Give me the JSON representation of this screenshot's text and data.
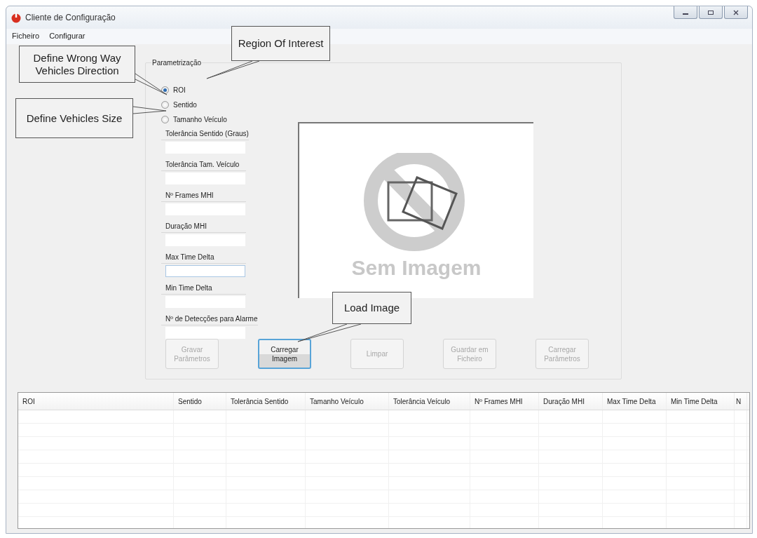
{
  "window": {
    "title": "Cliente de Configuração"
  },
  "menu": [
    {
      "label": "Ficheiro"
    },
    {
      "label": "Configurar"
    }
  ],
  "group": {
    "title": "Parametrização",
    "options": [
      {
        "label": "ROI",
        "selected": true
      },
      {
        "label": "Sentido",
        "selected": false
      },
      {
        "label": "Tamanho Veículo",
        "selected": false
      }
    ],
    "fields": [
      {
        "label": "Tolerância Sentido (Graus)",
        "focused": false
      },
      {
        "label": "Tolerância Tam. Veículo",
        "focused": false
      },
      {
        "label": "Nº Frames MHI",
        "focused": false
      },
      {
        "label": "Duração MHI",
        "focused": false
      },
      {
        "label": "Max Time Delta",
        "focused": true
      },
      {
        "label": "Min Time Delta",
        "focused": false
      },
      {
        "label": "Nº de Detecções para Alarme",
        "focused": false
      }
    ],
    "image": {
      "caption": "Sem Imagem"
    },
    "buttons": [
      {
        "label": "Gravar Parâmetros",
        "disabled": true,
        "focused": false
      },
      {
        "label": "Carregar Imagem",
        "disabled": false,
        "focused": true
      },
      {
        "label": "Limpar",
        "disabled": true,
        "focused": false
      },
      {
        "label": "Guardar em Ficheiro",
        "disabled": true,
        "focused": false
      },
      {
        "label": "Carregar Parâmetros",
        "disabled": true,
        "focused": false
      }
    ]
  },
  "table": {
    "columns": [
      "ROI",
      "Sentido",
      "Tolerância Sentido",
      "Tamanho Veículo",
      "Tolerância Veículo",
      "Nº Frames MHI",
      "Duração MHI",
      "Max Time Delta",
      "Min Time Delta",
      "N"
    ]
  },
  "callouts": [
    {
      "text": "Region Of Interest"
    },
    {
      "text": "Define Wrong Way Vehicles Direction"
    },
    {
      "text": "Define Vehicles Size"
    },
    {
      "text": "Load Image"
    }
  ]
}
